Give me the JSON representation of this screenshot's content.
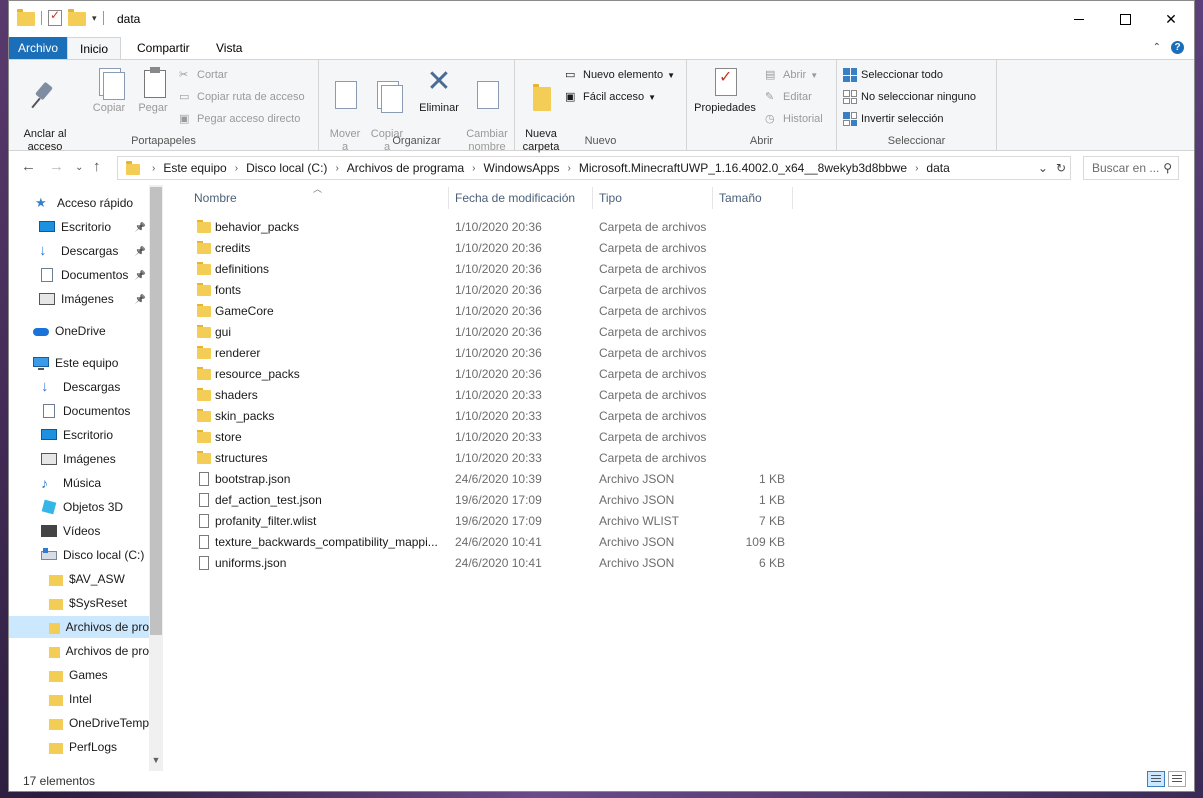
{
  "window": {
    "title": "data"
  },
  "ribbon_tabs": [
    "Archivo",
    "Inicio",
    "Compartir",
    "Vista"
  ],
  "ribbon": {
    "portapapeles": {
      "label": "Portapapeles",
      "anclar": "Anclar al\nacceso rápido",
      "copiar": "Copiar",
      "pegar": "Pegar",
      "cortar": "Cortar",
      "copiar_ruta": "Copiar ruta de acceso",
      "pegar_acceso": "Pegar acceso directo"
    },
    "organizar": {
      "label": "Organizar",
      "mover": "Mover\na",
      "copiar": "Copiar\na",
      "eliminar": "Eliminar",
      "cambiar": "Cambiar\nnombre"
    },
    "nuevo": {
      "label": "Nuevo",
      "nueva_carpeta": "Nueva\ncarpeta",
      "nuevo_elemento": "Nuevo elemento",
      "facil_acceso": "Fácil acceso"
    },
    "abrir": {
      "label": "Abrir",
      "propiedades": "Propiedades",
      "abrir": "Abrir",
      "editar": "Editar",
      "historial": "Historial"
    },
    "seleccionar": {
      "label": "Seleccionar",
      "todo": "Seleccionar todo",
      "ninguno": "No seleccionar ninguno",
      "invertir": "Invertir selección"
    }
  },
  "address": {
    "crumbs": [
      "Este equipo",
      "Disco local (C:)",
      "Archivos de programa",
      "WindowsApps",
      "Microsoft.MinecraftUWP_1.16.4002.0_x64__8wekyb3d8bbwe",
      "data"
    ],
    "search_placeholder": "Buscar en ..."
  },
  "sidebar": {
    "items": [
      {
        "label": "Acceso rápido",
        "icon": "star-icon"
      },
      {
        "label": "Escritorio",
        "icon": "desktop-icon"
      },
      {
        "label": "Descargas",
        "icon": "downloads-icon"
      },
      {
        "label": "Documentos",
        "icon": "documents-icon"
      },
      {
        "label": "Imágenes",
        "icon": "pictures-icon"
      },
      {
        "label": "OneDrive",
        "icon": "onedrive-icon"
      },
      {
        "label": "Este equipo",
        "icon": "computer-icon"
      },
      {
        "label": "Descargas",
        "icon": "downloads-icon"
      },
      {
        "label": "Documentos",
        "icon": "documents-icon"
      },
      {
        "label": "Escritorio",
        "icon": "desktop-icon"
      },
      {
        "label": "Imágenes",
        "icon": "pictures-icon"
      },
      {
        "label": "Música",
        "icon": "music-icon"
      },
      {
        "label": "Objetos 3D",
        "icon": "objects3d-icon"
      },
      {
        "label": "Vídeos",
        "icon": "videos-icon"
      },
      {
        "label": "Disco local (C:)",
        "icon": "drive-icon"
      },
      {
        "label": "$AV_ASW",
        "icon": "folder-icon"
      },
      {
        "label": "$SysReset",
        "icon": "folder-icon"
      },
      {
        "label": "Archivos de pro",
        "icon": "folder-icon"
      },
      {
        "label": "Archivos de pro",
        "icon": "folder-icon"
      },
      {
        "label": "Games",
        "icon": "folder-icon"
      },
      {
        "label": "Intel",
        "icon": "folder-icon"
      },
      {
        "label": "OneDriveTemp",
        "icon": "folder-icon"
      },
      {
        "label": "PerfLogs",
        "icon": "folder-icon"
      }
    ]
  },
  "columns": {
    "name": "Nombre",
    "date": "Fecha de modificación",
    "type": "Tipo",
    "size": "Tamaño"
  },
  "files": [
    {
      "name": "behavior_packs",
      "date": "1/10/2020 20:36",
      "type": "Carpeta de archivos",
      "size": "",
      "kind": "folder"
    },
    {
      "name": "credits",
      "date": "1/10/2020 20:36",
      "type": "Carpeta de archivos",
      "size": "",
      "kind": "folder"
    },
    {
      "name": "definitions",
      "date": "1/10/2020 20:36",
      "type": "Carpeta de archivos",
      "size": "",
      "kind": "folder"
    },
    {
      "name": "fonts",
      "date": "1/10/2020 20:36",
      "type": "Carpeta de archivos",
      "size": "",
      "kind": "folder"
    },
    {
      "name": "GameCore",
      "date": "1/10/2020 20:36",
      "type": "Carpeta de archivos",
      "size": "",
      "kind": "folder"
    },
    {
      "name": "gui",
      "date": "1/10/2020 20:36",
      "type": "Carpeta de archivos",
      "size": "",
      "kind": "folder"
    },
    {
      "name": "renderer",
      "date": "1/10/2020 20:36",
      "type": "Carpeta de archivos",
      "size": "",
      "kind": "folder"
    },
    {
      "name": "resource_packs",
      "date": "1/10/2020 20:36",
      "type": "Carpeta de archivos",
      "size": "",
      "kind": "folder"
    },
    {
      "name": "shaders",
      "date": "1/10/2020 20:33",
      "type": "Carpeta de archivos",
      "size": "",
      "kind": "folder"
    },
    {
      "name": "skin_packs",
      "date": "1/10/2020 20:33",
      "type": "Carpeta de archivos",
      "size": "",
      "kind": "folder"
    },
    {
      "name": "store",
      "date": "1/10/2020 20:33",
      "type": "Carpeta de archivos",
      "size": "",
      "kind": "folder"
    },
    {
      "name": "structures",
      "date": "1/10/2020 20:33",
      "type": "Carpeta de archivos",
      "size": "",
      "kind": "folder"
    },
    {
      "name": "bootstrap.json",
      "date": "24/6/2020 10:39",
      "type": "Archivo JSON",
      "size": "1 KB",
      "kind": "file"
    },
    {
      "name": "def_action_test.json",
      "date": "19/6/2020 17:09",
      "type": "Archivo JSON",
      "size": "1 KB",
      "kind": "file"
    },
    {
      "name": "profanity_filter.wlist",
      "date": "19/6/2020 17:09",
      "type": "Archivo WLIST",
      "size": "7 KB",
      "kind": "file"
    },
    {
      "name": "texture_backwards_compatibility_mappi...",
      "date": "24/6/2020 10:41",
      "type": "Archivo JSON",
      "size": "109 KB",
      "kind": "file"
    },
    {
      "name": "uniforms.json",
      "date": "24/6/2020 10:41",
      "type": "Archivo JSON",
      "size": "6 KB",
      "kind": "file"
    }
  ],
  "status": {
    "count": "17 elementos"
  },
  "colors": {
    "accent": "#1a6fb8",
    "selection": "#cce8ff",
    "folder": "#f4cd56"
  }
}
